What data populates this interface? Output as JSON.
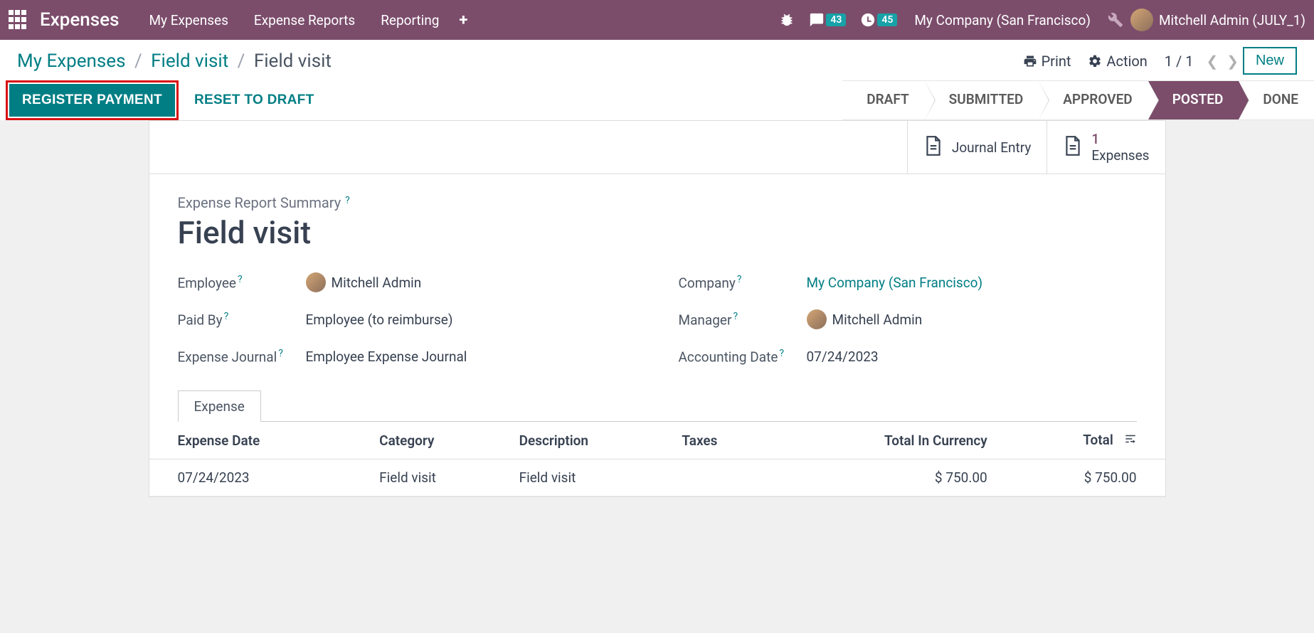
{
  "topnav": {
    "brand": "Expenses",
    "links": [
      "My Expenses",
      "Expense Reports",
      "Reporting"
    ],
    "messages_badge": "43",
    "activities_badge": "45",
    "company": "My Company (San Francisco)",
    "user": "Mitchell Admin (JULY_1)"
  },
  "breadcrumb": {
    "root": "My Expenses",
    "parent": "Field visit",
    "current": "Field visit"
  },
  "actions": {
    "print": "Print",
    "action": "Action",
    "pager": "1 / 1",
    "new": "New"
  },
  "buttons": {
    "register_payment": "REGISTER PAYMENT",
    "reset_draft": "RESET TO DRAFT"
  },
  "status": {
    "steps": [
      "DRAFT",
      "SUBMITTED",
      "APPROVED",
      "POSTED",
      "DONE"
    ],
    "active": "POSTED"
  },
  "statbuttons": {
    "journal_entry": "Journal Entry",
    "expenses_count": "1",
    "expenses_label": "Expenses"
  },
  "form": {
    "section_label": "Expense Report Summary",
    "title": "Field visit",
    "employee_label": "Employee",
    "employee_value": "Mitchell Admin",
    "paidby_label": "Paid By",
    "paidby_value": "Employee (to reimburse)",
    "journal_label": "Expense Journal",
    "journal_value": "Employee Expense Journal",
    "company_label": "Company",
    "company_value": "My Company (San Francisco)",
    "manager_label": "Manager",
    "manager_value": "Mitchell Admin",
    "accdate_label": "Accounting Date",
    "accdate_value": "07/24/2023"
  },
  "tab": {
    "expense": "Expense"
  },
  "table": {
    "headers": {
      "date": "Expense Date",
      "category": "Category",
      "description": "Description",
      "taxes": "Taxes",
      "total_currency": "Total In Currency",
      "total": "Total"
    },
    "rows": [
      {
        "date": "07/24/2023",
        "category": "Field visit",
        "description": "Field visit",
        "taxes": "",
        "total_currency": "$ 750.00",
        "total": "$ 750.00"
      }
    ]
  }
}
